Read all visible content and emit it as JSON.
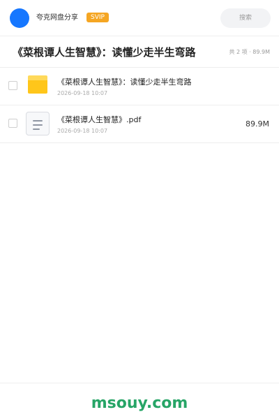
{
  "header": {
    "app_name": "夸克网盘分享",
    "badge": "SVIP",
    "search_placeholder": "搜索",
    "avatar_color": "#1677ff",
    "badge_color": "#f5a623"
  },
  "title_bar": {
    "title": "《菜根谭人生智慧》：读懂少走半生弯路",
    "summary": "共 2 项 · 89.9M"
  },
  "files": [
    {
      "name": "《菜根谭人生智慧》：读懂少走半生弯路",
      "date": "2026-09-18 10:07",
      "size": "",
      "icon": "folder-icon"
    },
    {
      "name": "《菜根谭人生智慧》.pdf",
      "date": "2026-09-18 10:07",
      "size": "89.9M",
      "icon": "document-icon"
    }
  ],
  "footer": {
    "watermark": "msouy.com",
    "watermark_color": "#27a567"
  }
}
